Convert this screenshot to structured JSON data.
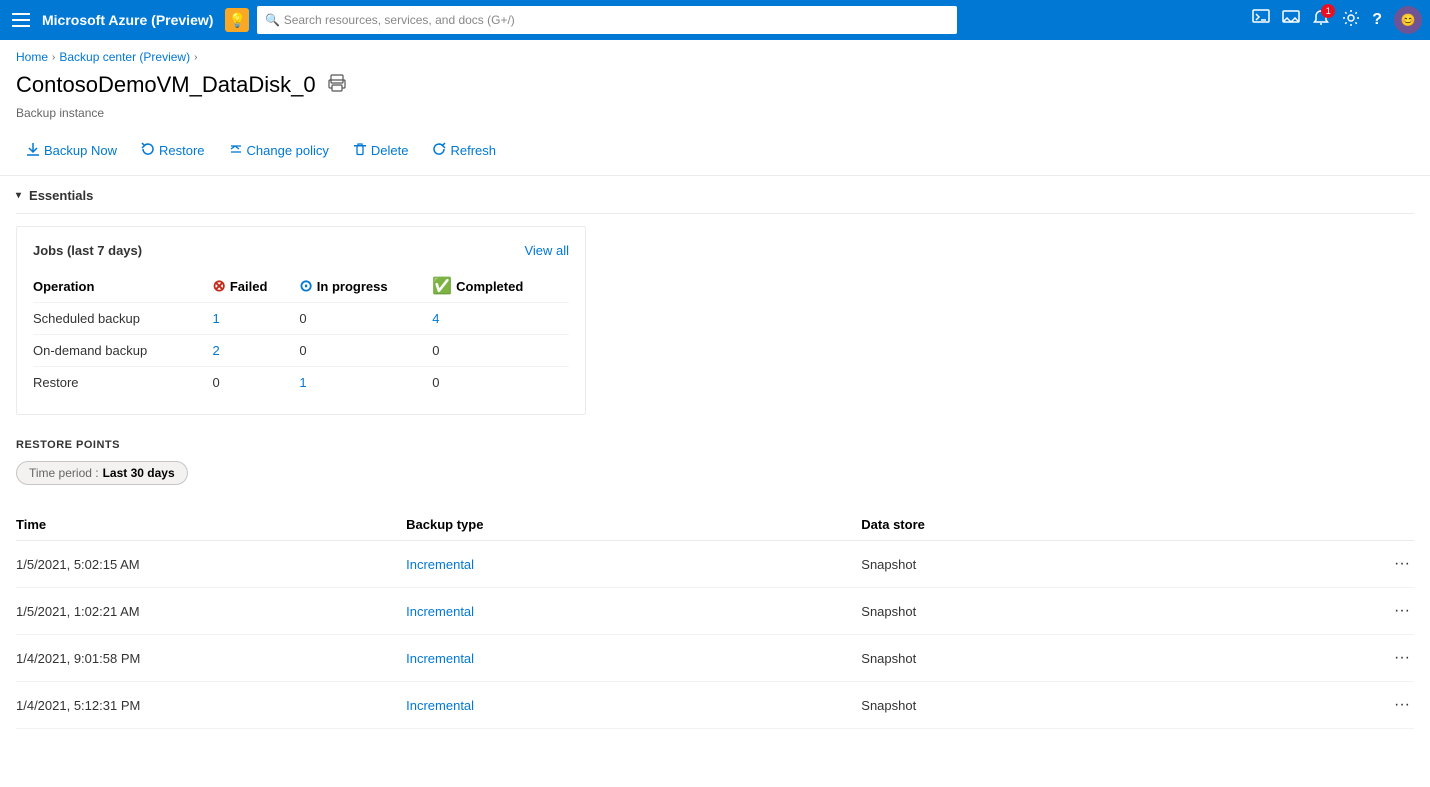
{
  "topNav": {
    "appTitle": "Microsoft Azure (Preview)",
    "searchPlaceholder": "Search resources, services, and docs (G+/)",
    "bulbIcon": "💡",
    "icons": {
      "terminal": "⬛",
      "feedback": "📋",
      "notifications": "🔔",
      "notifCount": "1",
      "settings": "⚙",
      "help": "?",
      "avatar": "😊"
    }
  },
  "breadcrumb": {
    "home": "Home",
    "parent": "Backup center (Preview)"
  },
  "pageHeader": {
    "title": "ContosoDemoVM_DataDisk_0",
    "subtitle": "Backup instance"
  },
  "toolbar": {
    "backupNow": "Backup Now",
    "restore": "Restore",
    "changePolicy": "Change policy",
    "delete": "Delete",
    "refresh": "Refresh"
  },
  "essentials": {
    "label": "Essentials"
  },
  "jobsCard": {
    "title": "Jobs (last 7 days)",
    "viewAll": "View all",
    "columns": {
      "operation": "Operation",
      "failed": "Failed",
      "inProgress": "In progress",
      "completed": "Completed"
    },
    "rows": [
      {
        "operation": "Scheduled backup",
        "failed": "1",
        "failedLink": true,
        "inProgress": "0",
        "inProgressLink": false,
        "completed": "4",
        "completedLink": true
      },
      {
        "operation": "On-demand backup",
        "failed": "2",
        "failedLink": true,
        "inProgress": "0",
        "inProgressLink": false,
        "completed": "0",
        "completedLink": false
      },
      {
        "operation": "Restore",
        "failed": "0",
        "failedLink": false,
        "inProgress": "1",
        "inProgressLink": true,
        "completed": "0",
        "completedLink": false
      }
    ]
  },
  "restorePoints": {
    "sectionTitle": "RESTORE POINTS",
    "timePeriodLabel": "Time period :",
    "timePeriodValue": "Last 30 days",
    "columns": {
      "time": "Time",
      "backupType": "Backup type",
      "dataStore": "Data store"
    },
    "rows": [
      {
        "time": "1/5/2021, 5:02:15 AM",
        "backupType": "Incremental",
        "dataStore": "Snapshot"
      },
      {
        "time": "1/5/2021, 1:02:21 AM",
        "backupType": "Incremental",
        "dataStore": "Snapshot"
      },
      {
        "time": "1/4/2021, 9:01:58 PM",
        "backupType": "Incremental",
        "dataStore": "Snapshot"
      },
      {
        "time": "1/4/2021, 5:12:31 PM",
        "backupType": "Incremental",
        "dataStore": "Snapshot"
      }
    ]
  }
}
